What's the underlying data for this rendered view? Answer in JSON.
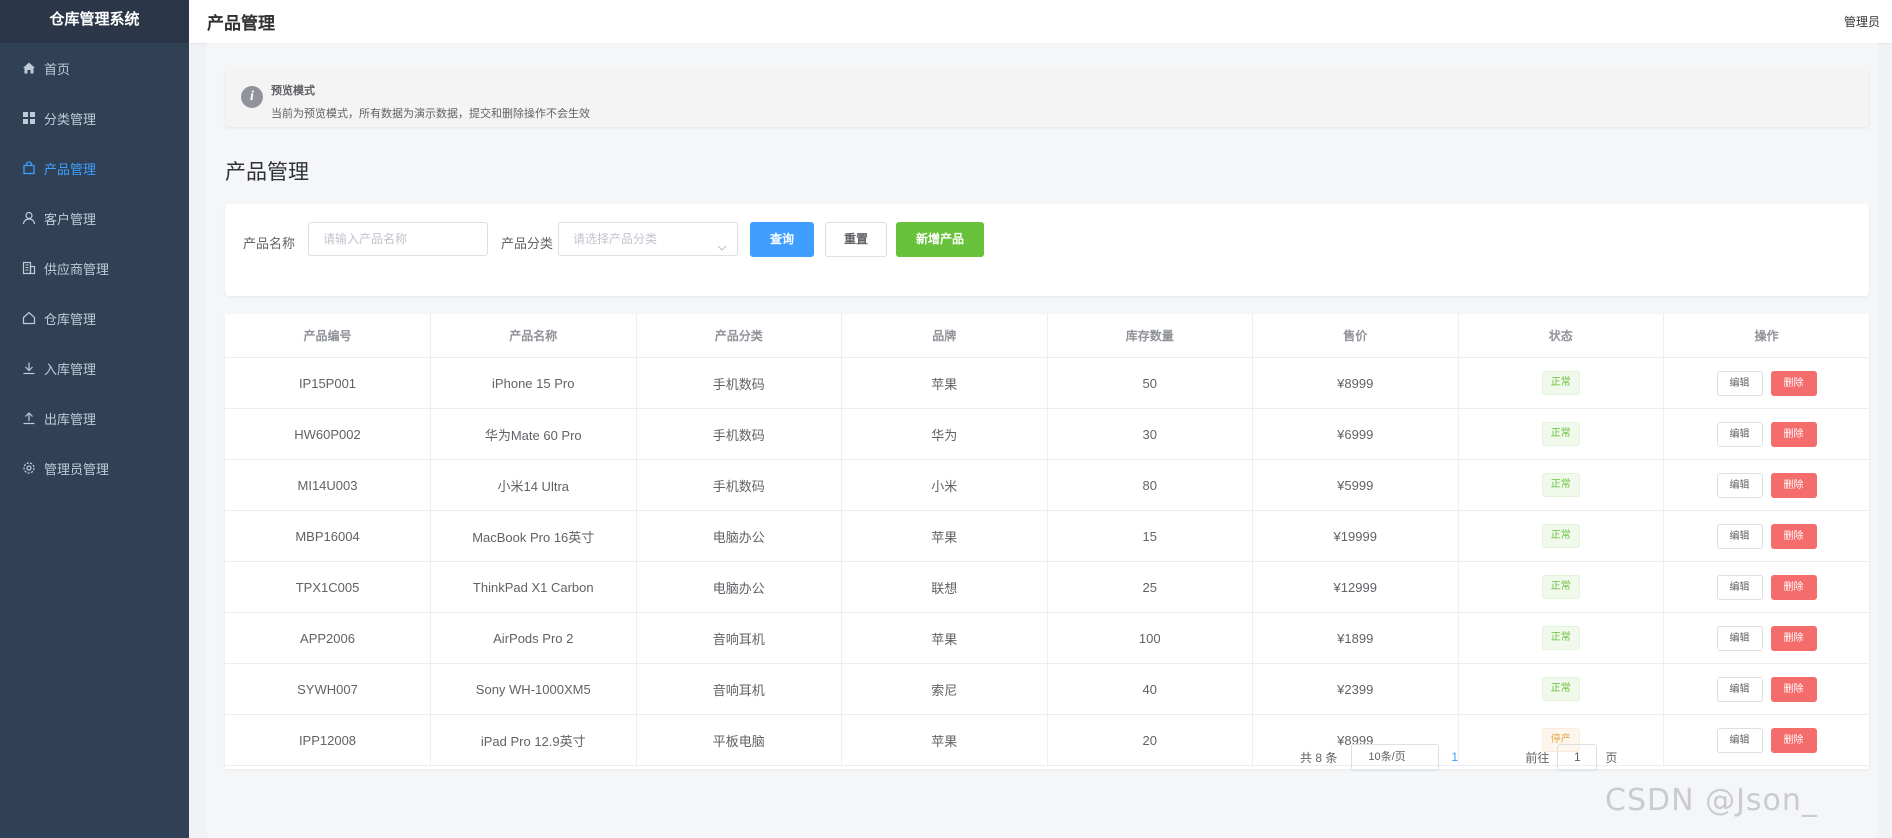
{
  "app": {
    "name": "仓库管理系统"
  },
  "sidebar": {
    "items": [
      {
        "label": "首页",
        "icon": "home-icon",
        "active": false
      },
      {
        "label": "分类管理",
        "icon": "grid-icon",
        "active": false
      },
      {
        "label": "产品管理",
        "icon": "bag-icon",
        "active": true
      },
      {
        "label": "客户管理",
        "icon": "user-icon",
        "active": false
      },
      {
        "label": "供应商管理",
        "icon": "building-icon",
        "active": false
      },
      {
        "label": "仓库管理",
        "icon": "house-icon",
        "active": false
      },
      {
        "label": "入库管理",
        "icon": "download-icon",
        "active": false
      },
      {
        "label": "出库管理",
        "icon": "upload-icon",
        "active": false
      },
      {
        "label": "管理员管理",
        "icon": "gear-icon",
        "active": false
      }
    ]
  },
  "header": {
    "title": "产品管理",
    "user": "管理员"
  },
  "alert": {
    "title": "预览模式",
    "description": "当前为预览模式，所有数据为演示数据，提交和删除操作不会生效",
    "icon": "info-icon"
  },
  "page": {
    "title": "产品管理"
  },
  "search": {
    "name_label": "产品名称",
    "name_placeholder": "请输入产品名称",
    "category_label": "产品分类",
    "category_placeholder": "请选择产品分类",
    "query_label": "查询",
    "reset_label": "重置",
    "add_label": "新增产品"
  },
  "table": {
    "columns": [
      "产品编号",
      "产品名称",
      "产品分类",
      "品牌",
      "库存数量",
      "售价",
      "状态",
      "操作"
    ],
    "edit_label": "编辑",
    "delete_label": "删除",
    "rows": [
      {
        "code": "IP15P001",
        "name": "iPhone 15 Pro",
        "category": "手机数码",
        "brand": "苹果",
        "stock": "50",
        "price": "¥8999",
        "status": "正常",
        "status_type": "ok"
      },
      {
        "code": "HW60P002",
        "name": "华为Mate 60 Pro",
        "category": "手机数码",
        "brand": "华为",
        "stock": "30",
        "price": "¥6999",
        "status": "正常",
        "status_type": "ok"
      },
      {
        "code": "MI14U003",
        "name": "小米14 Ultra",
        "category": "手机数码",
        "brand": "小米",
        "stock": "80",
        "price": "¥5999",
        "status": "正常",
        "status_type": "ok"
      },
      {
        "code": "MBP16004",
        "name": "MacBook Pro 16英寸",
        "category": "电脑办公",
        "brand": "苹果",
        "stock": "15",
        "price": "¥19999",
        "status": "正常",
        "status_type": "ok"
      },
      {
        "code": "TPX1C005",
        "name": "ThinkPad X1 Carbon",
        "category": "电脑办公",
        "brand": "联想",
        "stock": "25",
        "price": "¥12999",
        "status": "正常",
        "status_type": "ok"
      },
      {
        "code": "APP2006",
        "name": "AirPods Pro 2",
        "category": "音响耳机",
        "brand": "苹果",
        "stock": "100",
        "price": "¥1899",
        "status": "正常",
        "status_type": "ok"
      },
      {
        "code": "SYWH007",
        "name": "Sony WH-1000XM5",
        "category": "音响耳机",
        "brand": "索尼",
        "stock": "40",
        "price": "¥2399",
        "status": "正常",
        "status_type": "ok"
      },
      {
        "code": "IPP12008",
        "name": "iPad Pro 12.9英寸",
        "category": "平板电脑",
        "brand": "苹果",
        "stock": "20",
        "price": "¥8999",
        "status": "停产",
        "status_type": "stop"
      }
    ]
  },
  "pagination": {
    "total": "共 8 条",
    "page_size": "10条/页",
    "current_page": "1",
    "goto_label": "前往",
    "page_suffix": "页"
  },
  "watermark": "CSDN @Json_",
  "colors": {
    "sidebar_bg": "#304156",
    "primary": "#409eff",
    "success": "#67c23a",
    "danger": "#f56c6c",
    "warning": "#e6a23c"
  }
}
